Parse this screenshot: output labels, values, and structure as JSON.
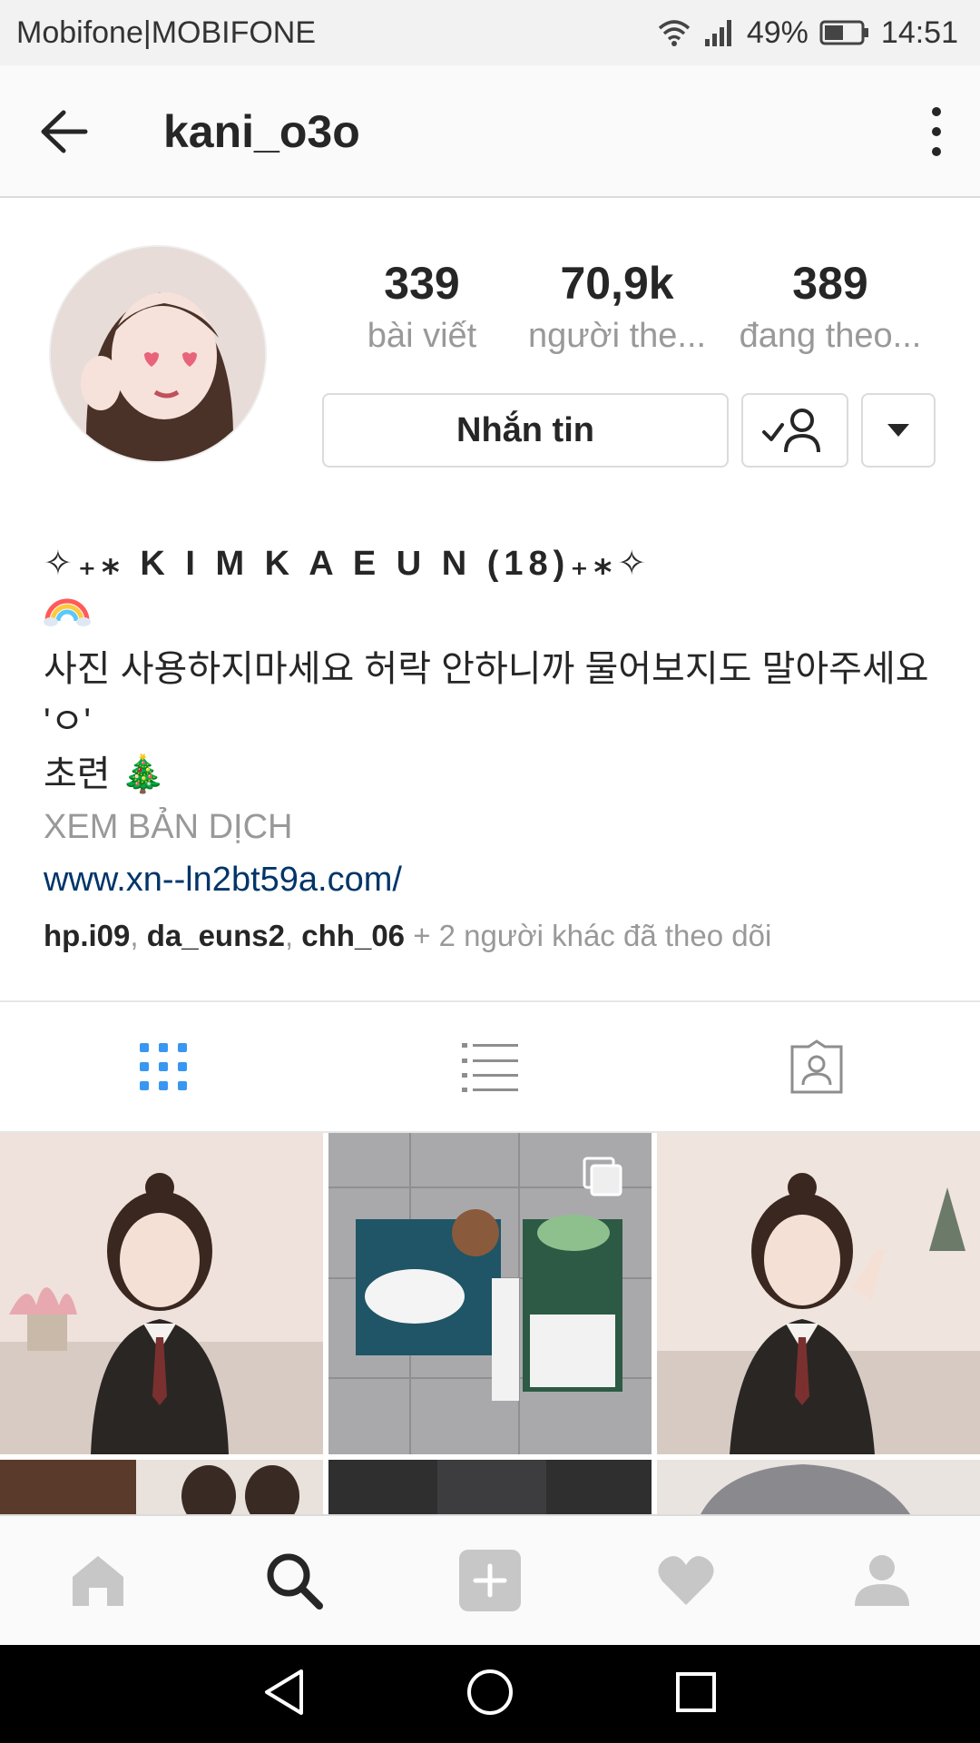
{
  "status_bar": {
    "carrier": "Mobifone|MOBIFONE",
    "battery": "49%",
    "time": "14:51"
  },
  "header": {
    "username": "kani_o3o"
  },
  "stats": {
    "posts_count": "339",
    "posts_label": "bài viết",
    "followers_count": "70,9k",
    "followers_label": "người the...",
    "following_count": "389",
    "following_label": "đang theo..."
  },
  "actions": {
    "message_label": "Nhắn tin"
  },
  "bio": {
    "name_line": "✧₊⁎ K I M  K A  E U N (18)₊⁎✧",
    "line1": "사진 사용하지마세요 허락 안하니까 물어보지도 말아주세요 'ㅇ'",
    "line2": "초련 🎄",
    "translate": "XEM BẢN DỊCH",
    "website": "www.xn--ln2bt59a.com/",
    "followed_user1": "hp.i09",
    "followed_user2": "da_euns2",
    "followed_user3": "chh_06",
    "followed_more": " + 2 người khác đã theo dõi"
  },
  "colors": {
    "accent_blue": "#3897f0",
    "link_blue": "#003569",
    "muted_grey": "#999999",
    "border": "#dbdbdb"
  },
  "tabs": [
    {
      "icon": "grid-icon",
      "active": true
    },
    {
      "icon": "list-icon",
      "active": false
    },
    {
      "icon": "tagged-icon",
      "active": false
    }
  ],
  "bottom_nav": [
    {
      "icon": "home-icon"
    },
    {
      "icon": "search-icon"
    },
    {
      "icon": "add-post-icon"
    },
    {
      "icon": "heart-icon"
    },
    {
      "icon": "profile-icon"
    }
  ]
}
